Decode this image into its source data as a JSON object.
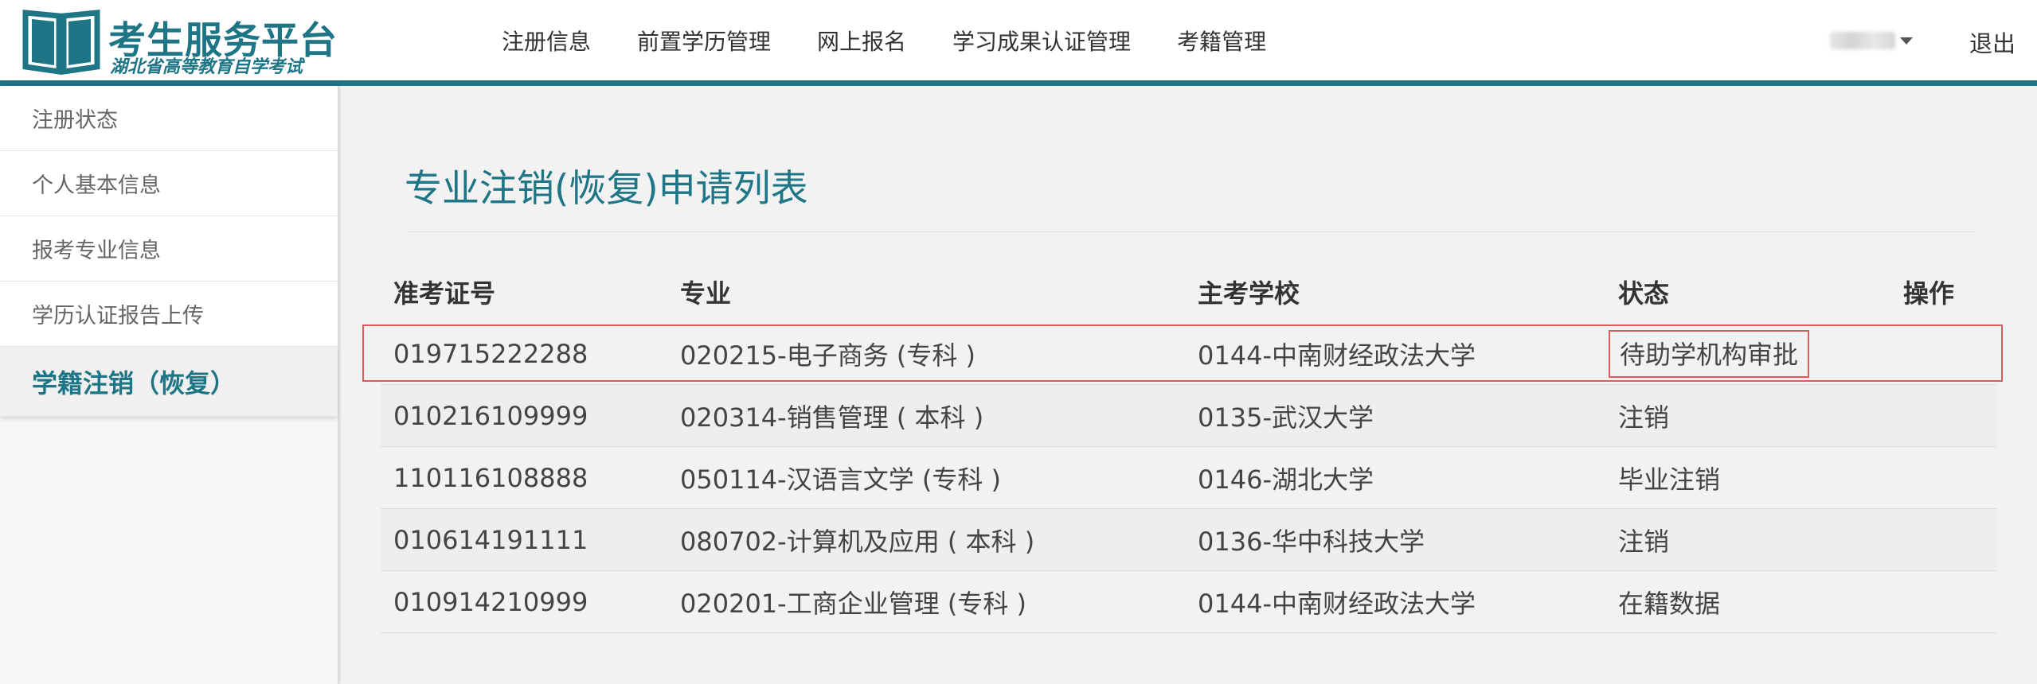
{
  "header": {
    "logo_title": "考生服务平台",
    "logo_subtitle": "湖北省高等教育自学考试",
    "nav": [
      "注册信息",
      "前置学历管理",
      "网上报名",
      "学习成果认证管理",
      "考籍管理"
    ],
    "logout_label": "退出"
  },
  "sidebar": {
    "items": [
      {
        "label": "注册状态"
      },
      {
        "label": "个人基本信息"
      },
      {
        "label": "报考专业信息"
      },
      {
        "label": "学历认证报告上传"
      },
      {
        "label": "学籍注销（恢复）"
      }
    ]
  },
  "main": {
    "title": "专业注销(恢复)申请列表",
    "columns": [
      "准考证号",
      "专业",
      "主考学校",
      "状态",
      "操作"
    ],
    "rows": [
      {
        "id": "019715222288",
        "major": "020215-电子商务 (专科 )",
        "school": "0144-中南财经政法大学",
        "status": "待助学机构审批",
        "action": ""
      },
      {
        "id": "010216109999",
        "major": "020314-销售管理 ( 本科 )",
        "school": "0135-武汉大学",
        "status": "注销",
        "action": ""
      },
      {
        "id": "110116108888",
        "major": "050114-汉语言文学 (专科 )",
        "school": "0146-湖北大学",
        "status": "毕业注销",
        "action": ""
      },
      {
        "id": "010614191111",
        "major": "080702-计算机及应用 ( 本科 )",
        "school": "0136-华中科技大学",
        "status": "注销",
        "action": ""
      },
      {
        "id": "010914210999",
        "major": "020201-工商企业管理 (专科 )",
        "school": "0144-中南财经政法大学",
        "status": "在籍数据",
        "action": ""
      }
    ]
  },
  "colors": {
    "brand": "#1d7586",
    "highlight": "#e05a5a"
  }
}
